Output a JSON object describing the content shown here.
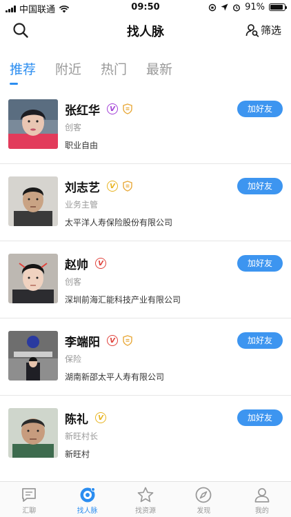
{
  "status_bar": {
    "carrier": "中国联通",
    "time": "09:50",
    "battery": "91%",
    "battery_level": 0.91
  },
  "header": {
    "title": "找人脉",
    "filter_label": "筛选",
    "search_icon": "search-icon",
    "filter_icon": "person-search-icon"
  },
  "tabs": [
    {
      "label": "推荐",
      "active": true
    },
    {
      "label": "附近",
      "active": false
    },
    {
      "label": "热门",
      "active": false
    },
    {
      "label": "最新",
      "active": false
    }
  ],
  "people": [
    {
      "name": "张红华",
      "role": "创客",
      "company": "职业自由",
      "add_label": "加好友",
      "badges": [
        "vip-purple",
        "shield"
      ]
    },
    {
      "name": "刘志艺",
      "role": "业务主管",
      "company": "太平洋人寿保险股份有限公司",
      "add_label": "加好友",
      "badges": [
        "vip-gold",
        "shield"
      ]
    },
    {
      "name": "赵帅",
      "role": "创客",
      "company": "深圳前海汇能科技产业有限公司",
      "add_label": "加好友",
      "badges": [
        "vip-red"
      ]
    },
    {
      "name": "李端阳",
      "role": "保险",
      "company": "湖南新邵太平人寿有限公司",
      "add_label": "加好友",
      "badges": [
        "vip-red",
        "shield"
      ]
    },
    {
      "name": "陈礼",
      "role": "新旺村长",
      "company": "新旺村",
      "add_label": "加好友",
      "badges": [
        "vip-gold"
      ]
    }
  ],
  "bottom_nav": [
    {
      "label": "汇聊",
      "icon": "chat-icon",
      "active": false
    },
    {
      "label": "找人脉",
      "icon": "network-icon",
      "active": true
    },
    {
      "label": "找资源",
      "icon": "star-icon",
      "active": false
    },
    {
      "label": "发现",
      "icon": "compass-icon",
      "active": false
    },
    {
      "label": "我的",
      "icon": "user-icon",
      "active": false
    }
  ],
  "colors": {
    "accent": "#2b8df0",
    "button": "#3d95f0",
    "vip_purple": "#a23fd6",
    "vip_gold": "#e8b420",
    "vip_red": "#e0413a",
    "shield": "#e8a838"
  }
}
